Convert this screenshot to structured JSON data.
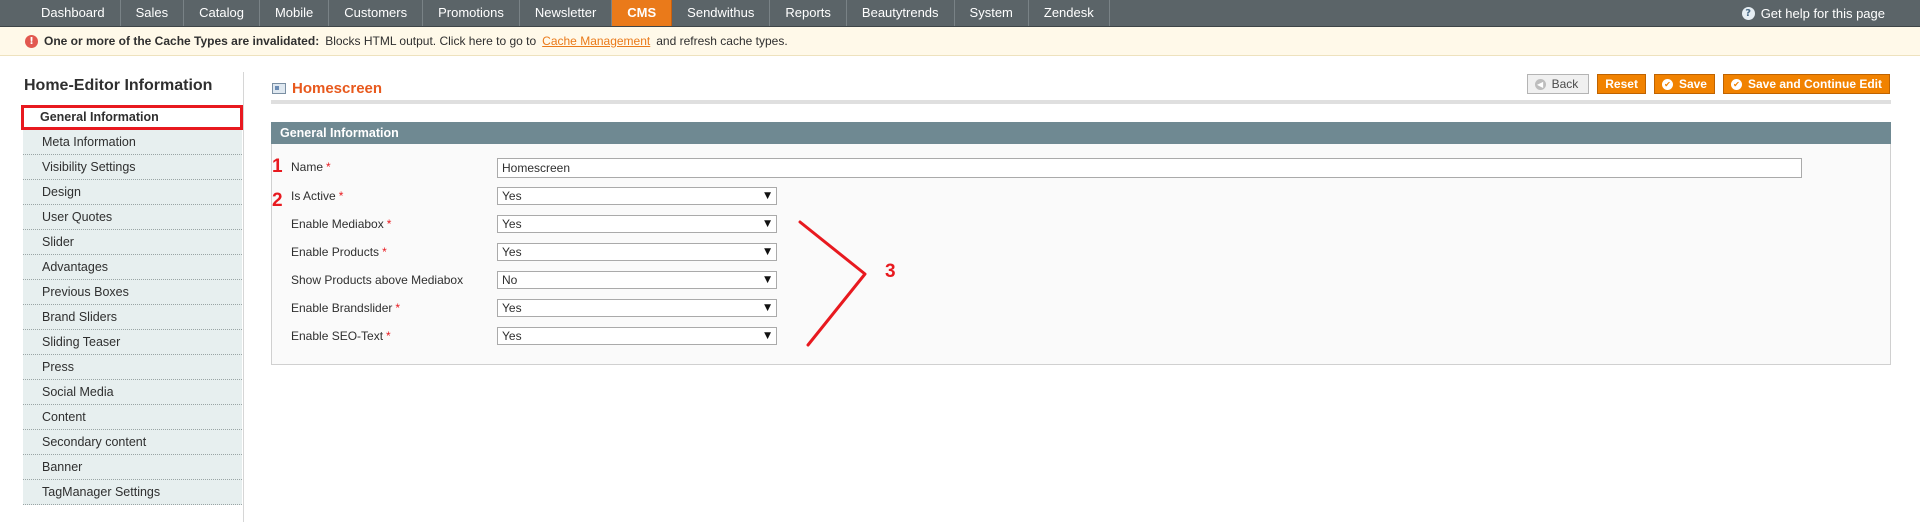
{
  "nav": {
    "items": [
      "Dashboard",
      "Sales",
      "Catalog",
      "Mobile",
      "Customers",
      "Promotions",
      "Newsletter",
      "CMS",
      "Sendwithus",
      "Reports",
      "Beautytrends",
      "System",
      "Zendesk"
    ],
    "active": "CMS",
    "help_text": "Get help for this page"
  },
  "notice": {
    "strong": "One or more of the Cache Types are invalidated:",
    "text_before": "Blocks HTML output. Click here to go to",
    "link": "Cache Management",
    "text_after": "and refresh cache types."
  },
  "sidebar": {
    "title": "Home-Editor Information",
    "tabs": [
      "General Information",
      "Meta Information",
      "Visibility Settings",
      "Design",
      "User Quotes",
      "Slider",
      "Advantages",
      "Previous Boxes",
      "Brand Sliders",
      "Sliding Teaser",
      "Press",
      "Social Media",
      "Content",
      "Secondary content",
      "Banner",
      "TagManager Settings"
    ]
  },
  "page": {
    "title": "Homescreen",
    "buttons": {
      "back": "Back",
      "reset": "Reset",
      "save": "Save",
      "save_continue": "Save and Continue Edit"
    }
  },
  "form": {
    "section_title": "General Information",
    "name_label": "Name",
    "name_value": "Homescreen",
    "fields": [
      {
        "label": "Is Active",
        "value": "Yes"
      },
      {
        "label": "Enable Mediabox",
        "value": "Yes"
      },
      {
        "label": "Enable Products",
        "value": "Yes"
      },
      {
        "label": "Show Products above Mediabox",
        "value": "No"
      },
      {
        "label": "Enable Brandslider",
        "value": "Yes"
      },
      {
        "label": "Enable SEO-Text",
        "value": "Yes"
      }
    ],
    "required_mark": "*"
  },
  "annotations": {
    "one": "1",
    "two": "2",
    "three": "3",
    "color": "#e8191f"
  },
  "colors": {
    "accent": "#ea7a1a",
    "nav_bg": "#5b6468",
    "section_header": "#6f8992",
    "title": "#e8591d"
  }
}
